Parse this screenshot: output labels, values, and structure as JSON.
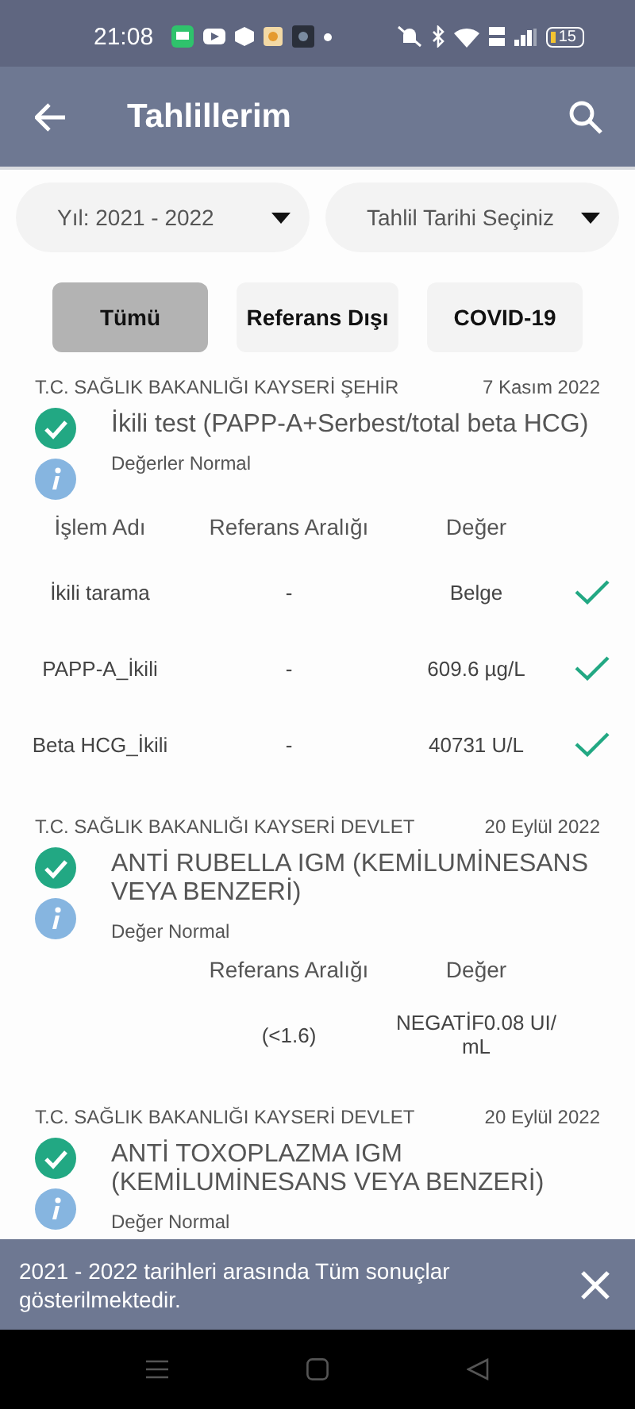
{
  "status_bar": {
    "time": "21:08",
    "battery": "15"
  },
  "app_bar": {
    "title": "Tahlillerim"
  },
  "filters": [
    {
      "label": "Yıl: 2021 - 2022"
    },
    {
      "label": "Tahlil Tarihi Seçiniz"
    }
  ],
  "chips": [
    {
      "label": "Tümü",
      "selected": true
    },
    {
      "label": "Referans Dışı",
      "selected": false
    },
    {
      "label": "COVID-19",
      "selected": false
    }
  ],
  "results": [
    {
      "institution": "T.C. SAĞLIK BAKANLIĞI KAYSERİ ŞEHİR",
      "date": "7 Kasım 2022",
      "title": "İkili test (PAPP-A+Serbest/total beta HCG)",
      "status": "Değerler Normal",
      "normal": true,
      "table": {
        "columns": {
          "name": "İşlem Adı",
          "range": "Referans Aralığı",
          "value": "Değer"
        },
        "rows": [
          {
            "name": "İkili tarama",
            "range": "-",
            "value": "Belge",
            "checked": true
          },
          {
            "name": "PAPP-A_İkili",
            "range": "-",
            "value": "609.6 µg/L",
            "checked": true
          },
          {
            "name": "Beta HCG_İkili",
            "range": "-",
            "value": "40731 U/L",
            "checked": true
          }
        ]
      }
    },
    {
      "institution": "T.C. SAĞLIK BAKANLIĞI KAYSERİ DEVLET",
      "date": "20 Eylül 2022",
      "title": "ANTİ RUBELLA IGM (KEMİLUMİNESANS VEYA BENZERİ)",
      "status": "Değer Normal",
      "normal": true,
      "table": {
        "columns": {
          "range": "Referans Aralığı",
          "value": "Değer"
        },
        "rows": [
          {
            "range": "(<1.6)",
            "value": "NEGATİF0.08 UI/ mL",
            "checked": false
          }
        ]
      }
    },
    {
      "institution": "T.C. SAĞLIK BAKANLIĞI KAYSERİ DEVLET",
      "date": "20 Eylül 2022",
      "title": "ANTİ TOXOPLAZMA IGM (KEMİLUMİNESANS VEYA BENZERİ)",
      "status": "Değer Normal",
      "normal": true
    }
  ],
  "snackbar": {
    "message": "2021 - 2022 tarihleri arasında Tüm sonuçlar gösterilmektedir."
  }
}
